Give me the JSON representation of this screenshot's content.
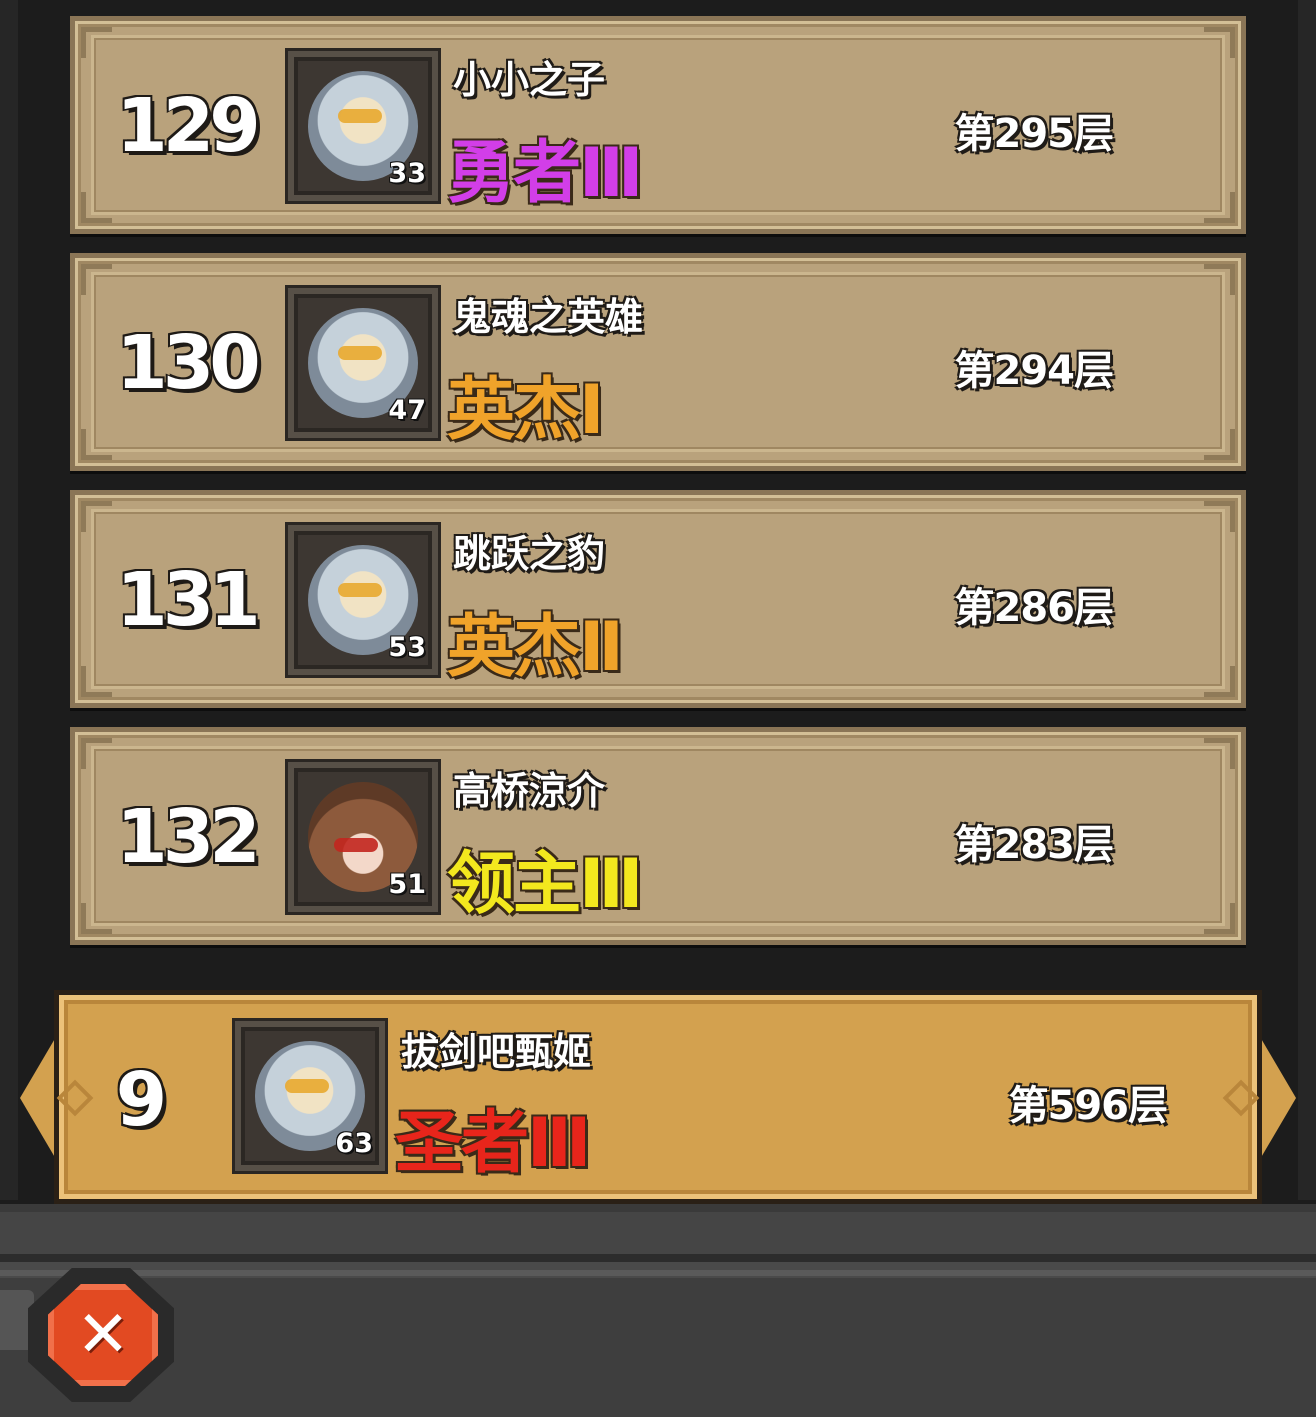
{
  "ranking": [
    {
      "rank": "129",
      "name": "小小之子",
      "title": "勇者Ⅲ",
      "title_color": "#d23ee8",
      "level": "33",
      "floor": "第295层",
      "avatar": "white-haired-hero"
    },
    {
      "rank": "130",
      "name": "鬼魂之英雄",
      "title": "英杰Ⅰ",
      "title_color": "#f0a32a",
      "level": "47",
      "floor": "第294层",
      "avatar": "white-haired-hero"
    },
    {
      "rank": "131",
      "name": "跳跃之豹",
      "title": "英杰Ⅱ",
      "title_color": "#f0a32a",
      "level": "53",
      "floor": "第286层",
      "avatar": "white-haired-hero"
    },
    {
      "rank": "132",
      "name": "高桥涼介",
      "title": "领主Ⅲ",
      "title_color": "#f3e81e",
      "level": "51",
      "floor": "第283层",
      "avatar": "hooded-hero"
    }
  ],
  "self": {
    "rank": "9",
    "name": "拔剑吧甄姬",
    "title": "圣者Ⅲ",
    "title_color": "#e8251b",
    "level": "63",
    "floor": "第596层",
    "avatar": "white-haired-hero"
  },
  "close_icon": "✕",
  "colors": {
    "row_bg": "#b9a27c",
    "self_row_bg": "#d3a14f",
    "close_button": "#e24a22"
  }
}
